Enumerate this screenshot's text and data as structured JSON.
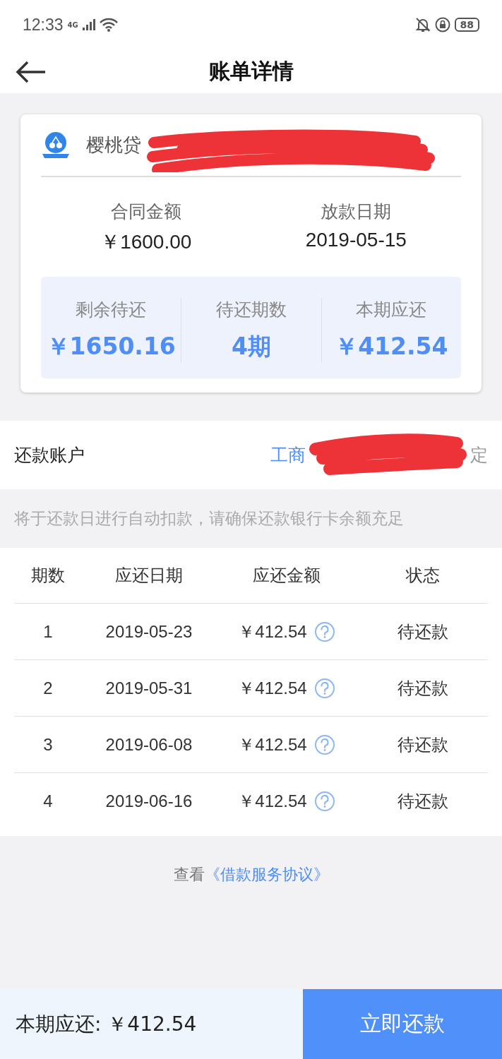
{
  "status_bar": {
    "time": "12:33",
    "network": "4G",
    "battery": "88"
  },
  "header": {
    "title": "账单详情"
  },
  "loan_card": {
    "lender": "樱桃贷",
    "contract_amount": {
      "label": "合同金额",
      "value": "￥1600.00"
    },
    "disbursement_date": {
      "label": "放款日期",
      "value": "2019-05-15"
    },
    "summary": [
      {
        "label": "剩余待还",
        "value": "￥1650.16"
      },
      {
        "label": "待还期数",
        "value": "4期"
      },
      {
        "label": "本期应还",
        "value": "￥412.54"
      }
    ]
  },
  "account": {
    "label": "还款账户",
    "bank": "工商",
    "action": "定"
  },
  "notice": "将于还款日进行自动扣款，请确保还款银行卡余额充足",
  "table": {
    "columns": [
      "期数",
      "应还日期",
      "应还金额",
      "状态"
    ],
    "rows": [
      {
        "period": "1",
        "date": "2019-05-23",
        "amount": "￥412.54",
        "status": "待还款"
      },
      {
        "period": "2",
        "date": "2019-05-31",
        "amount": "￥412.54",
        "status": "待还款"
      },
      {
        "period": "3",
        "date": "2019-06-08",
        "amount": "￥412.54",
        "status": "待还款"
      },
      {
        "period": "4",
        "date": "2019-06-16",
        "amount": "￥412.54",
        "status": "待还款"
      }
    ]
  },
  "agreement": {
    "prefix": "查看",
    "link": "《借款服务协议》"
  },
  "footer": {
    "due_label": "本期应还: ￥412.54",
    "pay_button": "立即还款"
  }
}
